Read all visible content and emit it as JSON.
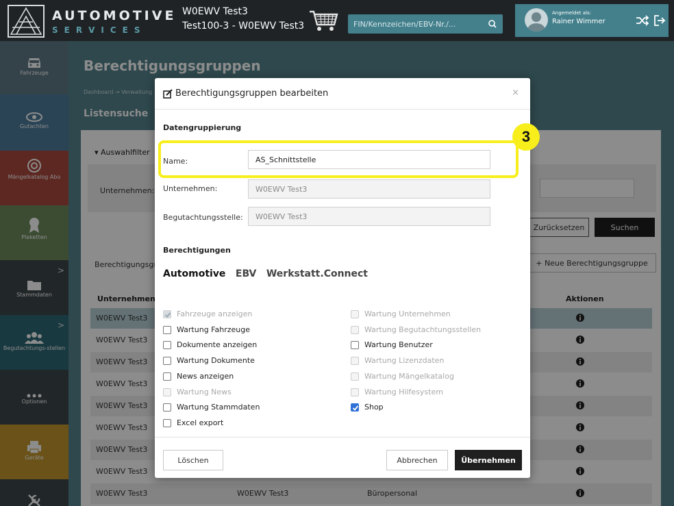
{
  "header": {
    "brand_line1": "AUTOMOTIVE",
    "brand_line2": "SERVICES",
    "context_line1": "W0EWV Test3",
    "context_line2": "Test100-3 - W0EWV Test3",
    "search_placeholder": "FIN/Kennzeichen/EBV-Nr./...",
    "user_label": "Angemeldet als:",
    "user_name": "Rainer Wimmer"
  },
  "sidebar": {
    "items": [
      {
        "label": "Fahrzeuge",
        "color": "#5e7a86"
      },
      {
        "label": "Gutachten",
        "color": "#4d7d9c"
      },
      {
        "label": "Mängelkatalog Abo",
        "color": "#a94a3e"
      },
      {
        "label": "Plaketten",
        "color": "#6e8a5b"
      },
      {
        "label": "Stammdaten",
        "color": "#3d4549"
      },
      {
        "label": "Begutachtungs-stellen",
        "color": "#2f6876"
      },
      {
        "label": "Optionen",
        "color": "#3d4549"
      },
      {
        "label": "Geräte",
        "color": "#c1952f"
      },
      {
        "label": "",
        "color": "#3d4549"
      }
    ]
  },
  "page": {
    "title": "Berechtigungsgruppen",
    "breadcrumb": "Dashboard → Verwaltung",
    "section": "Listensuche",
    "filter_toggle": "Auswahlfilter",
    "filter_label": "Unternehmen:",
    "reset_label": "Zurücksetzen",
    "search_label": "Suchen",
    "list_label": "Berechtigungsgruppen",
    "new_label": "Neue Berechtigungsgruppe",
    "col_company": "Unternehmen",
    "col_actions": "Aktionen",
    "rows": [
      {
        "c1": "W0EWV Test3",
        "c2": "",
        "c3": ""
      },
      {
        "c1": "W0EWV Test3",
        "c2": "",
        "c3": ""
      },
      {
        "c1": "W0EWV Test3",
        "c2": "",
        "c3": ""
      },
      {
        "c1": "W0EWV Test3",
        "c2": "",
        "c3": ""
      },
      {
        "c1": "W0EWV Test3",
        "c2": "",
        "c3": ""
      },
      {
        "c1": "W0EWV Test3",
        "c2": "",
        "c3": ""
      },
      {
        "c1": "W0EWV Test3",
        "c2": "",
        "c3": ""
      },
      {
        "c1": "W0EWV Test3",
        "c2": "",
        "c3": ""
      },
      {
        "c1": "W0EWV Test3",
        "c2": "W0EWV Test3",
        "c3": "Büropersonal"
      }
    ]
  },
  "modal": {
    "title": "Berechtigungsgruppen bearbeiten",
    "close": "×",
    "group_data": "Datengruppierung",
    "name_label": "Name:",
    "name_value": "AS_Schnittstelle",
    "company_label": "Unternehmen:",
    "company_value": "W0EWV Test3",
    "station_label": "Begutachtungsstelle:",
    "station_value": "W0EWV Test3",
    "group_perms": "Berechtigungen",
    "tabs": [
      "Automotive",
      "EBV",
      "Werkstatt.Connect"
    ],
    "perms_left": [
      {
        "label": "Fahrzeuge anzeigen",
        "checked": true,
        "disabled": true
      },
      {
        "label": "Wartung Fahrzeuge",
        "checked": false,
        "disabled": false
      },
      {
        "label": "Dokumente anzeigen",
        "checked": false,
        "disabled": false
      },
      {
        "label": "Wartung Dokumente",
        "checked": false,
        "disabled": false
      },
      {
        "label": "News anzeigen",
        "checked": false,
        "disabled": false
      },
      {
        "label": "Wartung News",
        "checked": false,
        "disabled": true
      },
      {
        "label": "Wartung Stammdaten",
        "checked": false,
        "disabled": false
      },
      {
        "label": "Excel export",
        "checked": false,
        "disabled": false
      }
    ],
    "perms_right": [
      {
        "label": "Wartung Unternehmen",
        "checked": false,
        "disabled": true
      },
      {
        "label": "Wartung Begutachtungsstellen",
        "checked": false,
        "disabled": true
      },
      {
        "label": "Wartung Benutzer",
        "checked": false,
        "disabled": false
      },
      {
        "label": "Wartung Lizenzdaten",
        "checked": false,
        "disabled": true
      },
      {
        "label": "Wartung Mängelkatalog",
        "checked": false,
        "disabled": true
      },
      {
        "label": "Wartung Hilfesystem",
        "checked": false,
        "disabled": true
      },
      {
        "label": "Shop",
        "checked": true,
        "disabled": false
      }
    ],
    "delete_label": "Löschen",
    "cancel_label": "Abbrechen",
    "apply_label": "Übernehmen"
  },
  "annotation": {
    "badge": "3",
    "color": "#f7ee1c"
  },
  "icons": {
    "logo": "car-wireframe-logo",
    "cart": "shopping-cart-icon",
    "search": "magnifier-icon",
    "shuffle": "shuffle-icon",
    "logout": "logout-icon",
    "edit": "edit-icon",
    "info": "info-circle-icon"
  }
}
